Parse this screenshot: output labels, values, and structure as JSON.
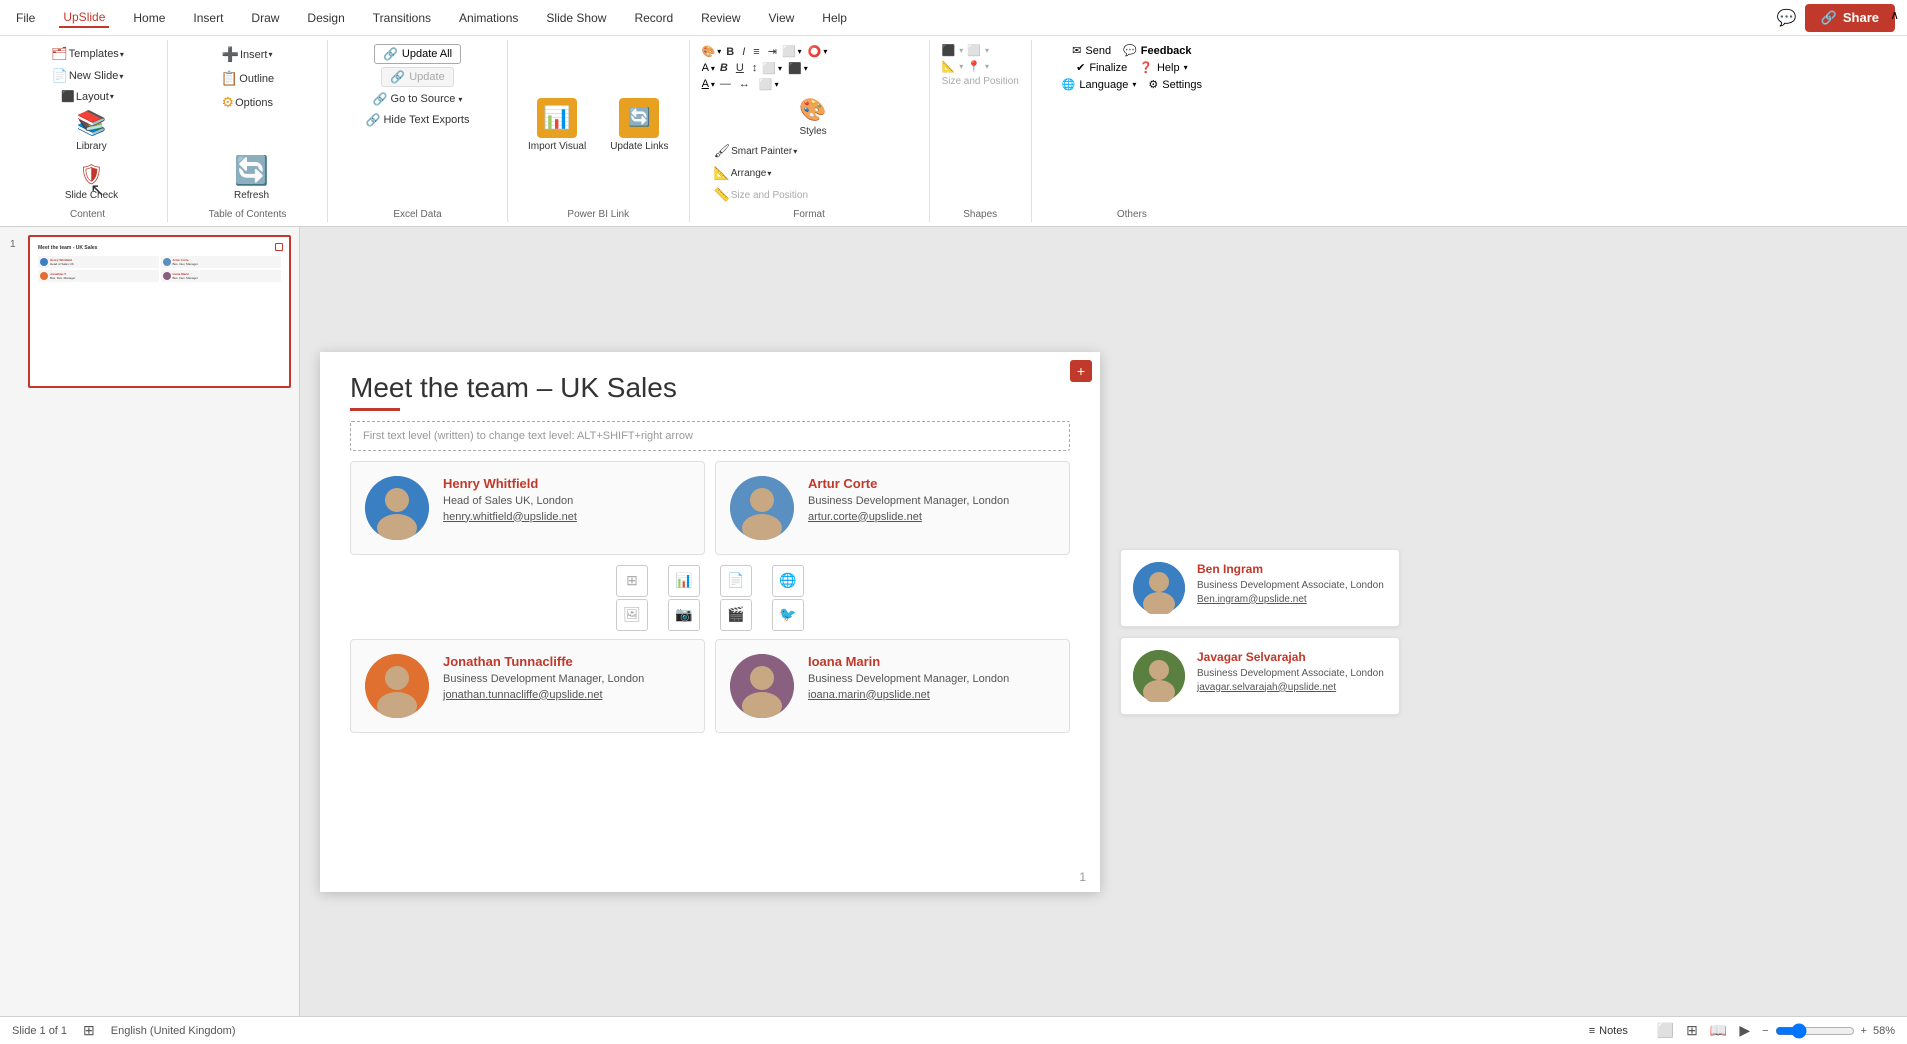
{
  "titlebar": {
    "menus": [
      "File",
      "UpSlide",
      "Home",
      "Insert",
      "Draw",
      "Design",
      "Transitions",
      "Animations",
      "Slide Show",
      "Record",
      "Review",
      "View",
      "Help"
    ],
    "active_menu": "UpSlide",
    "share_label": "Share",
    "chat_icon": "💬"
  },
  "ribbon": {
    "groups": [
      {
        "name": "Content",
        "label": "Content",
        "buttons": [
          {
            "id": "templates",
            "label": "Templates",
            "icon": "🗂️",
            "has_dropdown": true
          },
          {
            "id": "new-slide",
            "label": "New Slide",
            "icon": "📄",
            "has_dropdown": true
          },
          {
            "id": "layout",
            "label": "Layout",
            "icon": "⬛",
            "has_dropdown": true
          },
          {
            "id": "library",
            "label": "Library",
            "icon": "📚"
          },
          {
            "id": "slide-check",
            "label": "Slide Check",
            "icon": "✅"
          }
        ]
      },
      {
        "name": "Table of Contents",
        "label": "Table of Contents",
        "buttons": [
          {
            "id": "insert",
            "label": "Insert",
            "icon": "➕",
            "has_dropdown": true
          },
          {
            "id": "outline",
            "label": "Outline",
            "icon": "📋"
          },
          {
            "id": "options",
            "label": "Options",
            "icon": "⚙️"
          },
          {
            "id": "refresh",
            "label": "Refresh",
            "icon": "🔄"
          }
        ]
      },
      {
        "name": "Excel Data",
        "label": "Excel Data",
        "buttons": [
          {
            "id": "update-all",
            "label": "Update All",
            "icon": "🔗"
          },
          {
            "id": "update-disabled",
            "label": "Update",
            "icon": "🔗",
            "disabled": true
          },
          {
            "id": "go-to-source",
            "label": "Go to Source",
            "icon": "🔗",
            "has_dropdown": true
          },
          {
            "id": "hide-text-exports",
            "label": "Hide Text Exports",
            "icon": "🔗"
          }
        ]
      },
      {
        "name": "Power BI Link",
        "label": "Power BI Link",
        "buttons": [
          {
            "id": "import-visual",
            "label": "Import Visual",
            "icon": "📊"
          },
          {
            "id": "update-links",
            "label": "Update Links",
            "icon": "🔄"
          }
        ]
      },
      {
        "name": "Format",
        "label": "Format",
        "buttons": [
          {
            "id": "styles",
            "label": "Styles",
            "icon": "🎨"
          },
          {
            "id": "smart-painter",
            "label": "Smart Painter",
            "icon": "🖌️"
          },
          {
            "id": "arrange",
            "label": "Arrange",
            "icon": "📐"
          },
          {
            "id": "size-position",
            "label": "Size and Position",
            "icon": "📏"
          }
        ]
      },
      {
        "name": "Shapes",
        "label": "Shapes",
        "buttons": []
      },
      {
        "name": "Others",
        "label": "Others",
        "buttons": [
          {
            "id": "send",
            "label": "Send",
            "icon": "✉️"
          },
          {
            "id": "feedback",
            "label": "Feedback",
            "icon": "💬"
          },
          {
            "id": "finalize",
            "label": "Finalize",
            "icon": "✔️"
          },
          {
            "id": "help",
            "label": "Help",
            "icon": "❓"
          },
          {
            "id": "language",
            "label": "Language",
            "icon": "🌐"
          },
          {
            "id": "settings",
            "label": "Settings",
            "icon": "⚙️"
          }
        ]
      }
    ]
  },
  "slide": {
    "number": 1,
    "title": "Meet the team – UK Sales",
    "placeholder_text": "First text level (written) to change text level: ALT+SHIFT+right arrow",
    "page_number": "1",
    "team_members": [
      {
        "id": "henry",
        "name": "Henry Whitfield",
        "role": "Head of Sales UK, London",
        "email": "henry.whitfield@upslide.net",
        "avatar_color": "#3a7fc1"
      },
      {
        "id": "artur",
        "name": "Artur Corte",
        "role": "Business Development Manager, London",
        "email": "artur.corte@upslide.net",
        "avatar_color": "#5a8fc1"
      },
      {
        "id": "jonathan",
        "name": "Jonathan Tunnacliffe",
        "role": "Business Development Manager, London",
        "email": "jonathan.tunnacliffe@upslide.net",
        "avatar_color": "#e07030"
      },
      {
        "id": "ioana",
        "name": "Ioana Marin",
        "role": "Business Development Manager, London",
        "email": "ioana.marin@upslide.net",
        "avatar_color": "#8a6080"
      }
    ],
    "overflow_cards": [
      {
        "id": "ben",
        "name": "Ben Ingram",
        "role": "Business Development Associate, London",
        "email": "Ben.ingram@upslide.net",
        "avatar_color": "#3a7fc1"
      },
      {
        "id": "javagar",
        "name": "Javagar Selvarajah",
        "role": "Business Development Associate, London",
        "email": "javagar.selvarajah@upslide.net",
        "avatar_color": "#5a8040"
      }
    ]
  },
  "statusbar": {
    "slide_info": "Slide 1 of 1",
    "language": "English (United Kingdom)",
    "notes_label": "Notes",
    "zoom_level": "58%"
  }
}
